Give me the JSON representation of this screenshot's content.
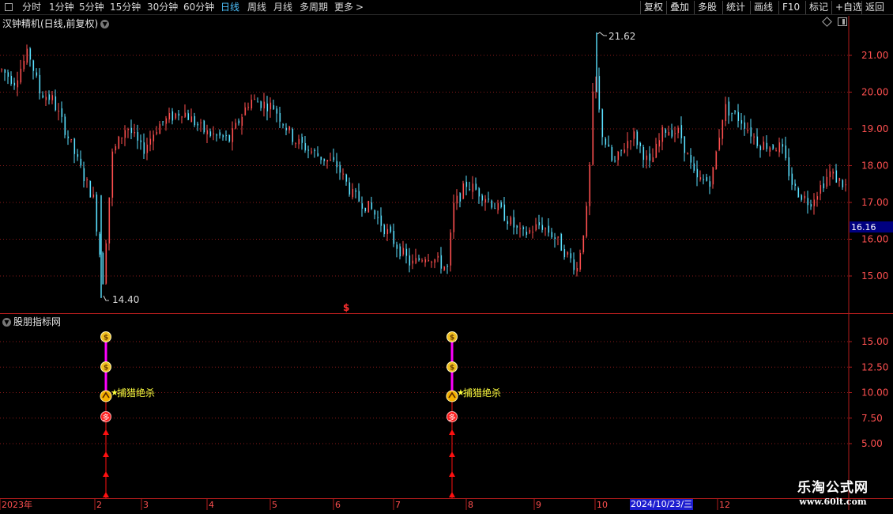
{
  "toolbar": {
    "left_items": [
      {
        "label": "分时"
      },
      {
        "label": "1分钟"
      },
      {
        "label": "5分钟"
      },
      {
        "label": "15分钟"
      },
      {
        "label": "30分钟"
      },
      {
        "label": "60分钟"
      },
      {
        "label": "日线",
        "active": true
      },
      {
        "label": "周线"
      },
      {
        "label": "月线"
      },
      {
        "label": "多周期"
      },
      {
        "label": "更多"
      }
    ],
    "more_arrow": ">",
    "right_items": [
      {
        "label": "复权"
      },
      {
        "label": "叠加"
      },
      {
        "label": "多股"
      },
      {
        "label": "统计"
      },
      {
        "label": "画线"
      },
      {
        "label": "F10"
      },
      {
        "label": "标记"
      },
      {
        "label": "+自选"
      },
      {
        "label": "返回"
      }
    ]
  },
  "main_chart": {
    "title": "汉钟精机(日线,前复权)",
    "price_labels": [
      "21.00",
      "20.00",
      "19.00",
      "18.00",
      "17.00",
      "16.00",
      "15.00"
    ],
    "current_price": "16.16",
    "high_label": "21.62",
    "low_label": "14.40",
    "marker_symbol": "$",
    "colors": {
      "up": "#ff4f4f",
      "down": "#5ae1ff",
      "grid": "#8a1a1a",
      "axis": "#b01c1c",
      "price_box": "#000080"
    }
  },
  "indicator": {
    "title": "股朋指标网",
    "value_labels": [
      "15.00",
      "12.50",
      "10.00",
      "7.50",
      "5.00"
    ],
    "signal_text": "捕猎绝杀",
    "signal_star": "★",
    "bag_glyph": "$",
    "ball_glyph": "多",
    "colors": {
      "bar": "#ff00ff",
      "arrow": "#ff1010",
      "text": "#ffff40",
      "bag": "#f0c020",
      "ball": "#ff2020"
    }
  },
  "x_axis": {
    "labels": [
      "2023年",
      "2",
      "3",
      "4",
      "5",
      "6",
      "7",
      "8",
      "9",
      "10",
      "12"
    ],
    "date_cursor": "2024/10/23/三"
  },
  "watermark": {
    "title": "乐淘公式网",
    "url": "www.60lt.com"
  }
}
